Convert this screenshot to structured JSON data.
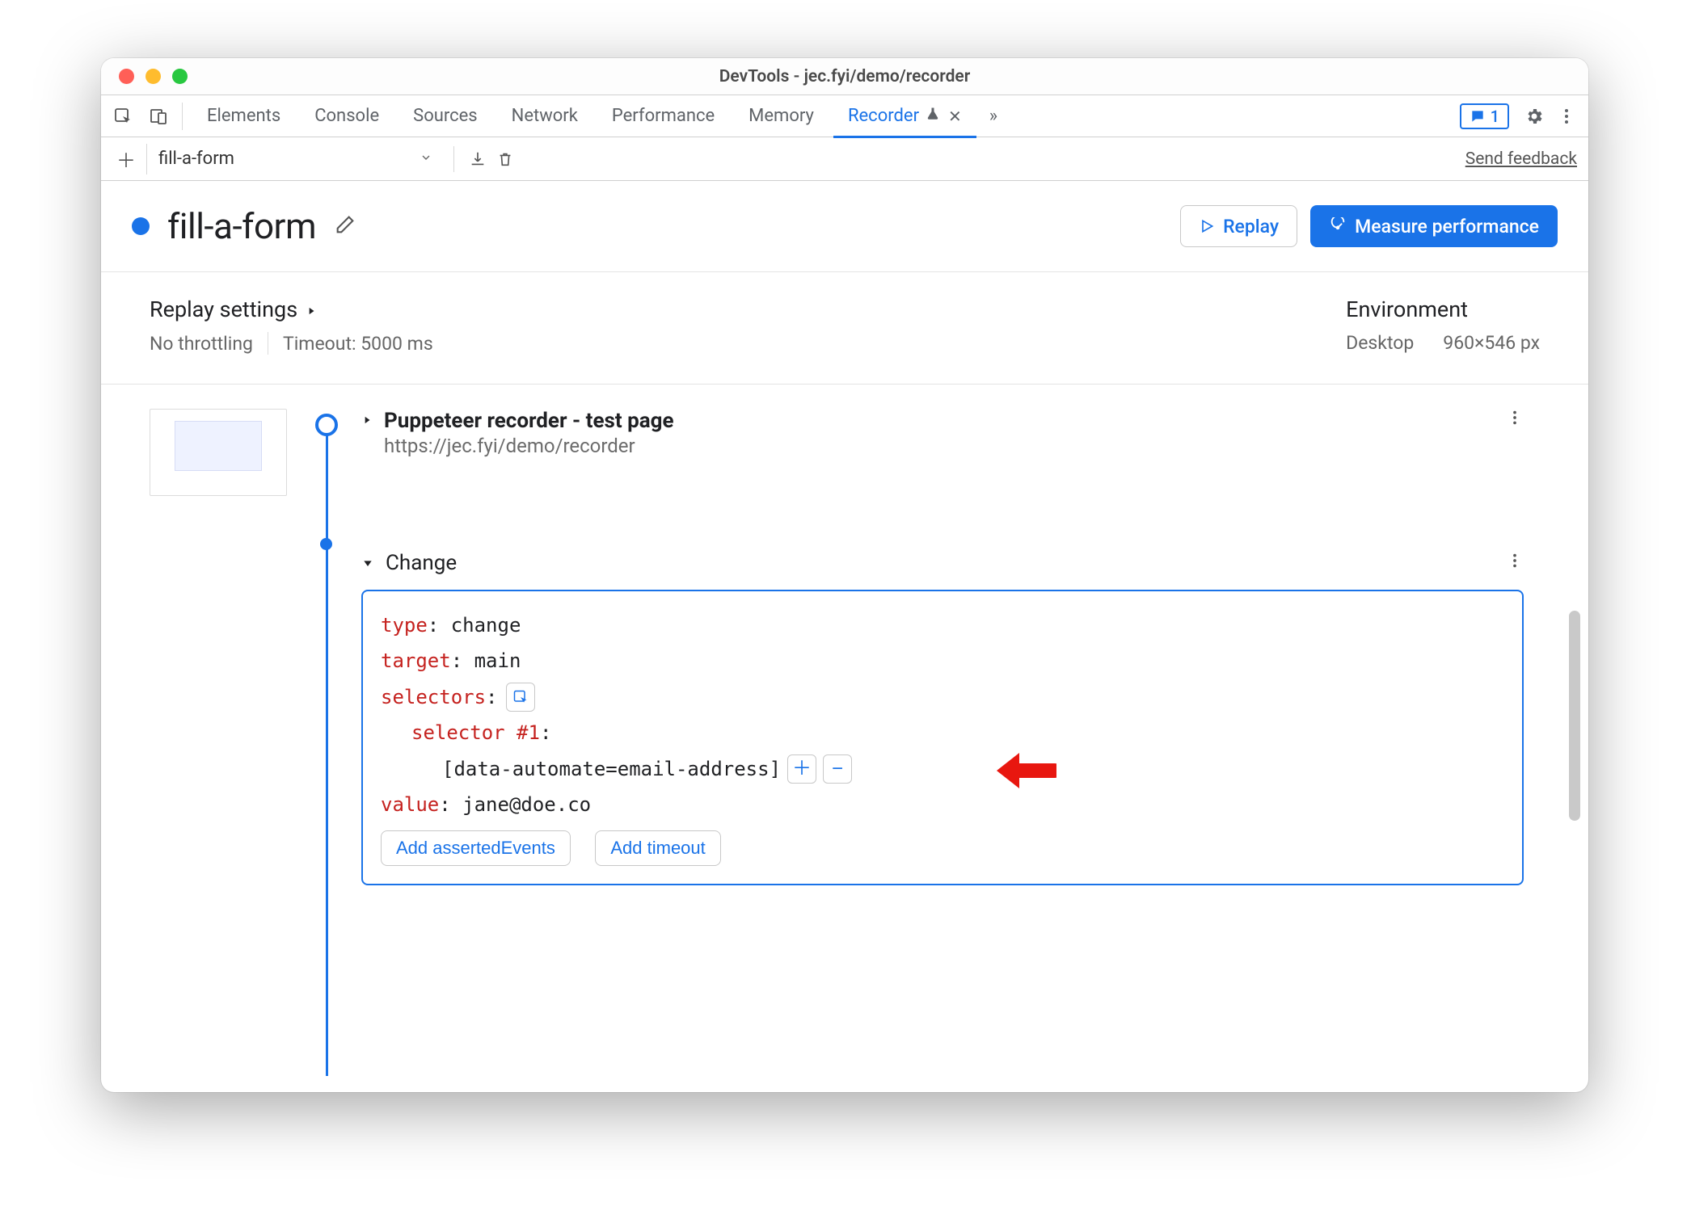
{
  "window": {
    "title": "DevTools - jec.fyi/demo/recorder"
  },
  "tabs": {
    "items": [
      "Elements",
      "Console",
      "Sources",
      "Network",
      "Performance",
      "Memory",
      "Recorder"
    ],
    "activeIndex": 6,
    "issues_count": "1"
  },
  "toolbar": {
    "recording_name": "fill-a-form",
    "send_feedback": "Send feedback"
  },
  "header": {
    "title": "fill-a-form",
    "replay_label": "Replay",
    "measure_label": "Measure performance"
  },
  "settings": {
    "replay_heading": "Replay settings",
    "throttling": "No throttling",
    "timeout": "Timeout: 5000 ms",
    "env_heading": "Environment",
    "device": "Desktop",
    "viewport": "960×546 px"
  },
  "steps": {
    "start": {
      "title": "Puppeteer recorder - test page",
      "url": "https://jec.fyi/demo/recorder"
    },
    "change": {
      "label": "Change",
      "kv": {
        "type_key": "type",
        "type_val": "change",
        "target_key": "target",
        "target_val": "main",
        "selectors_key": "selectors",
        "selector1_key": "selector #1",
        "selector1_val": "[data-automate=email-address]",
        "value_key": "value",
        "value_val": "jane@doe.co"
      },
      "add_asserted": "Add assertedEvents",
      "add_timeout": "Add timeout"
    }
  }
}
